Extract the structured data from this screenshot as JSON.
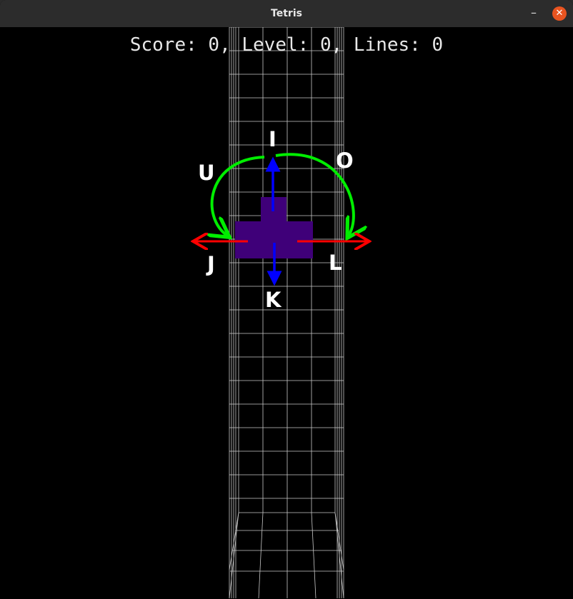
{
  "window": {
    "title": "Tetris",
    "minimize": "–",
    "close": "✕"
  },
  "hud": {
    "score": 0,
    "level": 0,
    "lines": 0,
    "text": "Score: 0, Level: 0, Lines: 0"
  },
  "controls": {
    "rotate_left": "U",
    "up": "I",
    "rotate_right": "O",
    "left": "J",
    "down": "K",
    "right": "L"
  },
  "colors": {
    "piece": "#3f0079",
    "grid": "#c8c8c8",
    "rotate_arrows": "#00ee00",
    "horizontal_arrows": "#ff0000",
    "vertical_arrows": "#0000ff",
    "close_button": "#e95420"
  },
  "icons": {
    "minimize": "minimize-icon",
    "close": "close-icon",
    "rotate_left": "rotate-left-arrow-icon",
    "rotate_right": "rotate-right-arrow-icon"
  }
}
